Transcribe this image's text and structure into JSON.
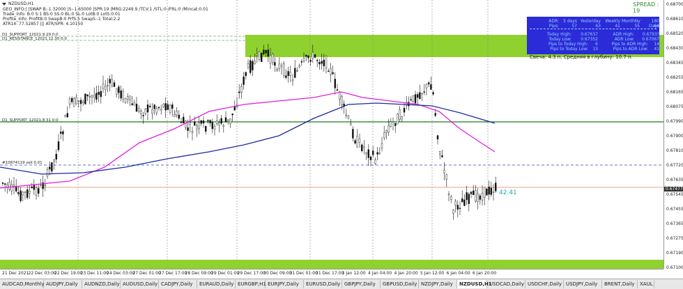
{
  "window": {
    "symbol_title": "NZDUSD,H1"
  },
  "info_lines": [
    "GEO_INFO:| |SWAP B:-1.32000 |S:-1.65000 |SPR:19 |MRG:2249.9 /TCV:1 /STL:0 /FRL:0 /Mincat:0.01",
    "Trade_Info: B:0 S:1 BS:0 SS:0 BL:0 SL:0 LotB:0 LotS:0.01",
    "Profite_Info: ProfitB:0 SwapB:0 PrfS:5 SwapS:-1 Total:2.2",
    "ATR14: 77.52857 ||| ATR/SPR: 4.10150"
  ],
  "hlines": {
    "support_top": "D1_SUPPORT_12021.9.29 0:0",
    "resistance_top": "D1_RESISTANCE_12021.12.30 0:0",
    "support_mid": "D1_SUPPORT_12021.8.31 0:0",
    "order_line": "#10874119 sell 0.01"
  },
  "spread": "SPREAD : 19",
  "adr_panel": {
    "headers": [
      "ADR:",
      "5 days",
      "Yesterday",
      "Weekly",
      "MonthNy",
      "180 Days"
    ],
    "pips_row": [
      "Pips:",
      "57",
      "63",
      "41",
      "55",
      "64"
    ],
    "today_high": {
      "label": "Today High:",
      "value": "0.67637",
      "label2": "ADR High:",
      "value2": "0.6793?"
    },
    "today_low": {
      "label": "Today Low:",
      "value": "0.67352",
      "label2": "ADR Low:",
      "value2": "0.67067"
    },
    "pips_high": {
      "label": "Pips to Today High:",
      "value": "6",
      "label2": "Pips to ADR High:",
      "value2": "14"
    },
    "pips_low": {
      "label": "Pips to Today Low:",
      "value": "13",
      "label2": "Pips to ADR Low:",
      "value2": "41"
    }
  },
  "candle_text": "Свеча: 4.3 п. Средняя в глубину: 10.7 п.",
  "price_label": "42.41",
  "price_axis": [
    "0.68700",
    "0.68610",
    "0.68520",
    "0.68430",
    "0.68345",
    "0.68255",
    "0.68165",
    "0.68075",
    "0.67990",
    "0.67900",
    "0.67810",
    "0.67720",
    "0.67635",
    "0.67545",
    "0.67455",
    "0.67365",
    "0.67275",
    "0.67190",
    "0.67100"
  ],
  "current_price": "0.67477",
  "time_axis": [
    "21 Dec 2021",
    "22 Dec 03:00",
    "22 Dec 19:00",
    "23 Dec 11:00",
    "24 Dec 03:00",
    "27 Dec 01:00",
    "27 Dec 17:00",
    "28 Dec 09:00",
    "29 Dec 01:00",
    "29 Dec 17:00",
    "30 Dec 09:00",
    "31 Dec 01:00",
    "31 Dec 17:00",
    "3 Jan 12:00",
    "4 Jan 04:00",
    "4 Jan 20:00",
    "5 Jan 12:00",
    "6 Jan 04:00",
    "6 Jan 20:00"
  ],
  "tabs": [
    "AUDCAD,Monthly",
    "AUDJPY,Daily",
    "AUDNZD,Daily",
    "AUDUSD,Daily",
    "CADJPY,Daily",
    "EURAUD,Daily",
    "EURGBP,H1",
    "EURJPY,Daily",
    "EURUSD,Daily",
    "GBPJPY,Daily",
    "GBPUSD,Daily",
    "NZDJPY,Daily",
    "NZDUSD,H1",
    "USDCAD,Daily",
    "USDCHF,Daily",
    "USDJPY,Daily",
    "BRENT,Daily",
    "XAUL"
  ],
  "active_tab": "NZDUSD,H1",
  "colors": {
    "zone": "#8fd12e",
    "ma_fast": "#e020e0",
    "ma_slow": "#1a2aa0",
    "support": "#1a7a1a",
    "adr_bg": "#2b2bd8"
  }
}
